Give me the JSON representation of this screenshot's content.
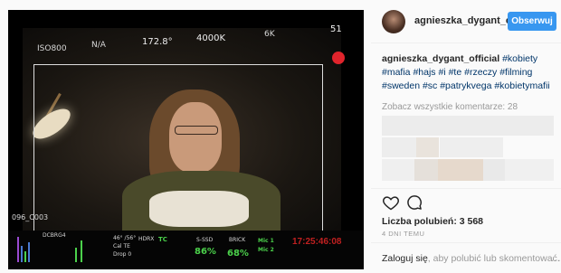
{
  "media": {
    "hud_top": {
      "iso": "ISO800",
      "na": "N/A",
      "shutter": "172.8°",
      "wb": "4000K",
      "res": "6K",
      "slot": "51"
    },
    "hud_bottom": {
      "clip": "096_C003",
      "codec": "DCBRG4",
      "iris": "46° /56°",
      "cal": "Cal TE",
      "drop": "Drop 0",
      "hdrx": "HDRX",
      "tc_label": "TC",
      "media_label": "S-SSD",
      "media_pct": "86%",
      "brick_label": "BRICK",
      "brick_pct": "68%",
      "mic1": "Mic 1",
      "mic2": "Mic 2",
      "timecode": "17:25:46:08"
    },
    "rec_color": "#e0242c"
  },
  "header": {
    "username": "agnieszka_dygant_off",
    "follow_label": "Obserwuj"
  },
  "caption": {
    "username": "agnieszka_dygant_official",
    "tags": [
      "#kobiety",
      "#mafia",
      "#hajs",
      "#i",
      "#te",
      "#rzeczy",
      "#filming",
      "#sweden",
      "#sc",
      "#patrykvega",
      "#kobietymafii"
    ]
  },
  "comments": {
    "view_all": "Zobacz wszystkie komentarze: 28"
  },
  "actions": {
    "likes_text": "Liczba polubień: 3 568"
  },
  "timestamp": "4 DNI TEMU",
  "footer": {
    "login_link": "Zaloguj się",
    "login_rest": ", aby polubić lub skomentować.",
    "more": "…"
  },
  "colors": {
    "accent": "#3897f0",
    "hashtag": "#003569",
    "hud_green": "#4bd14b"
  }
}
